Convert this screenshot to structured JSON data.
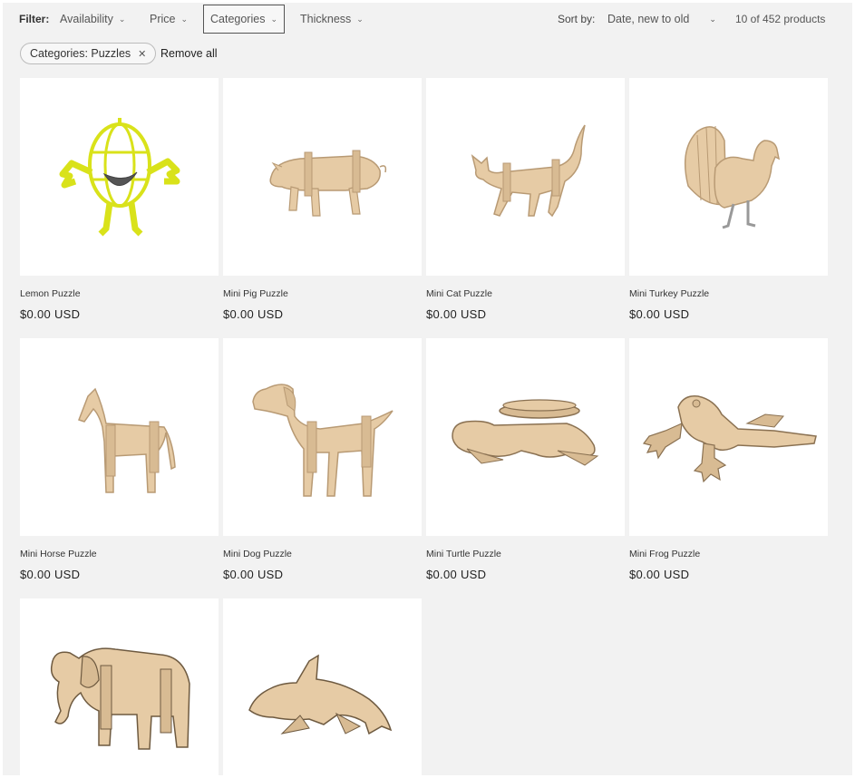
{
  "filter": {
    "label": "Filter:",
    "items": [
      {
        "label": "Availability",
        "name": "filter-availability"
      },
      {
        "label": "Price",
        "name": "filter-price"
      },
      {
        "label": "Categories",
        "name": "filter-categories"
      },
      {
        "label": "Thickness",
        "name": "filter-thickness"
      }
    ]
  },
  "sort": {
    "label": "Sort by:",
    "value": "Date, new to old"
  },
  "count": "10 of 452 products",
  "active_filter": {
    "label": "Categories: Puzzles",
    "remove_all": "Remove all"
  },
  "colors": {
    "wood": "#e6cba5",
    "wood_dark": "#b89a74",
    "lemon": "#d9e21a",
    "page_bg": "#f2f2f2"
  },
  "products": [
    {
      "title": "Lemon Puzzle",
      "price": "$0.00 USD",
      "image_icon": "lemon-puzzle-icon"
    },
    {
      "title": "Mini Pig Puzzle",
      "price": "$0.00 USD",
      "image_icon": "pig-puzzle-icon"
    },
    {
      "title": "Mini Cat Puzzle",
      "price": "$0.00 USD",
      "image_icon": "cat-puzzle-icon"
    },
    {
      "title": "Mini Turkey Puzzle",
      "price": "$0.00 USD",
      "image_icon": "turkey-puzzle-icon"
    },
    {
      "title": "Mini Horse Puzzle",
      "price": "$0.00 USD",
      "image_icon": "horse-puzzle-icon"
    },
    {
      "title": "Mini Dog Puzzle",
      "price": "$0.00 USD",
      "image_icon": "dog-puzzle-icon"
    },
    {
      "title": "Mini Turtle Puzzle",
      "price": "$0.00 USD",
      "image_icon": "turtle-puzzle-icon"
    },
    {
      "title": "Mini Frog Puzzle",
      "price": "$0.00 USD",
      "image_icon": "frog-puzzle-icon"
    },
    {
      "title": "",
      "price": "",
      "image_icon": "elephant-puzzle-icon"
    },
    {
      "title": "",
      "price": "",
      "image_icon": "dolphin-puzzle-icon"
    }
  ]
}
